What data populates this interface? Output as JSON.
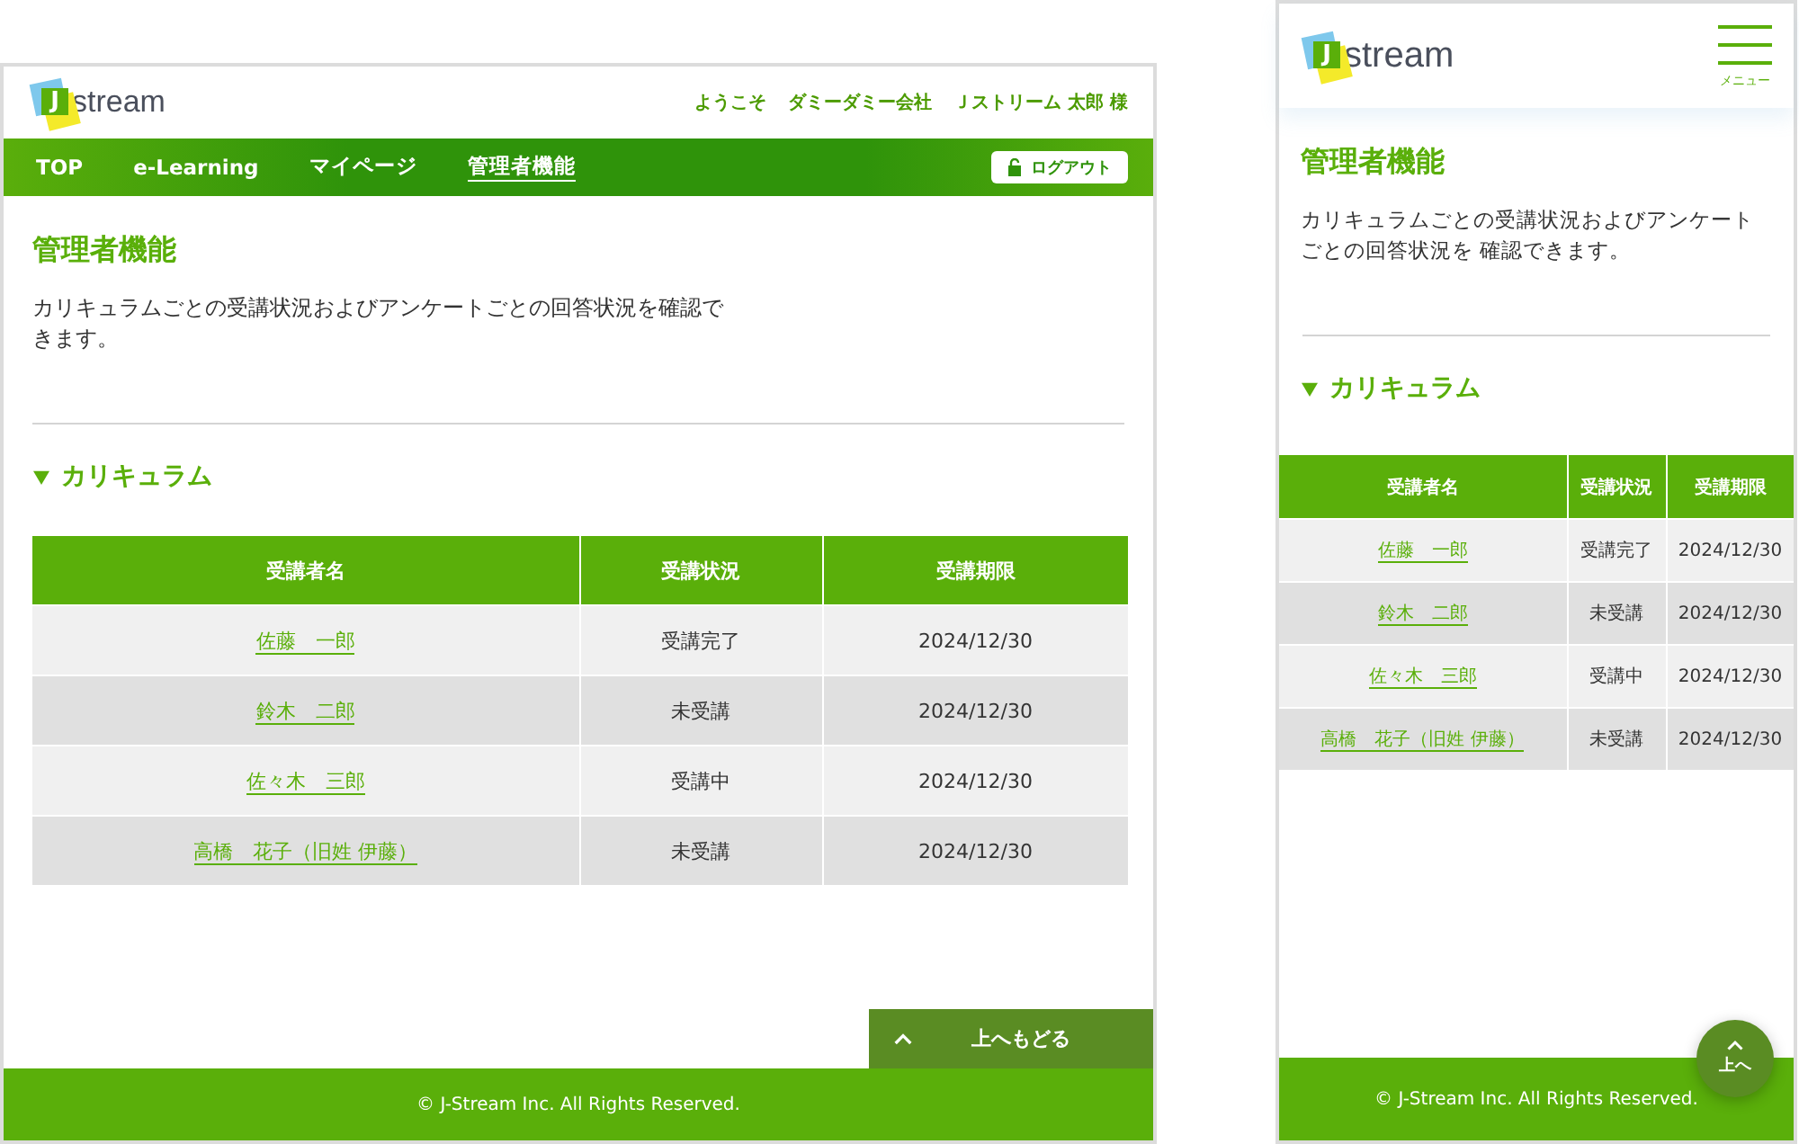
{
  "desktop": {
    "logo": {
      "mark": "J",
      "text": "stream"
    },
    "greeting": [
      "ようこそ",
      "ダミーダミー会社",
      "Ｊストリーム 太郎 様"
    ],
    "nav": [
      {
        "label": "TOP",
        "selected": false
      },
      {
        "label": "e-Learning",
        "selected": false
      },
      {
        "label": "マイページ",
        "selected": false
      },
      {
        "label": "管理者機能",
        "selected": true
      }
    ],
    "logout": "ログアウト",
    "title": "管理者機能",
    "description": "カリキュラムごとの受講状況およびアンケートごとの回答状況を確認できます。",
    "section": {
      "title": "カリキュラム",
      "expanded": true
    },
    "table": {
      "columns": [
        "受講者名",
        "受講状況",
        "受講期限"
      ],
      "rows": [
        {
          "name": "佐藤　一郎",
          "status": "受講完了",
          "deadline": "2024/12/30"
        },
        {
          "name": "鈴木　二郎",
          "status": "未受講",
          "deadline": "2024/12/30"
        },
        {
          "name": "佐々木　三郎",
          "status": "受講中",
          "deadline": "2024/12/30"
        },
        {
          "name": "高橋　花子（旧姓 伊藤）",
          "status": "未受講",
          "deadline": "2024/12/30"
        }
      ]
    },
    "back_to_top": "上へもどる",
    "footer": "© J-Stream Inc. All Rights Reserved."
  },
  "mobile": {
    "logo": {
      "mark": "J",
      "text": "stream"
    },
    "menu": "メニュー",
    "title": "管理者機能",
    "description": "カリキュラムごとの受講状況およびアンケートごとの回答状況を 確認できます。",
    "section": {
      "title": "カリキュラム",
      "expanded": true
    },
    "table": {
      "columns": [
        "受講者名",
        "受講状況",
        "受講期限"
      ],
      "rows": [
        {
          "name": "佐藤　一郎",
          "status": "受講完了",
          "deadline": "2024/12/30"
        },
        {
          "name": "鈴木　二郎",
          "status": "未受講",
          "deadline": "2024/12/30"
        },
        {
          "name": "佐々木　三郎",
          "status": "受講中",
          "deadline": "2024/12/30"
        },
        {
          "name": "高橋　花子（旧姓 伊藤）",
          "status": "未受講",
          "deadline": "2024/12/30"
        }
      ]
    },
    "back_to_top": "上へ",
    "footer": "© J-Stream Inc. All Rights Reserved."
  }
}
